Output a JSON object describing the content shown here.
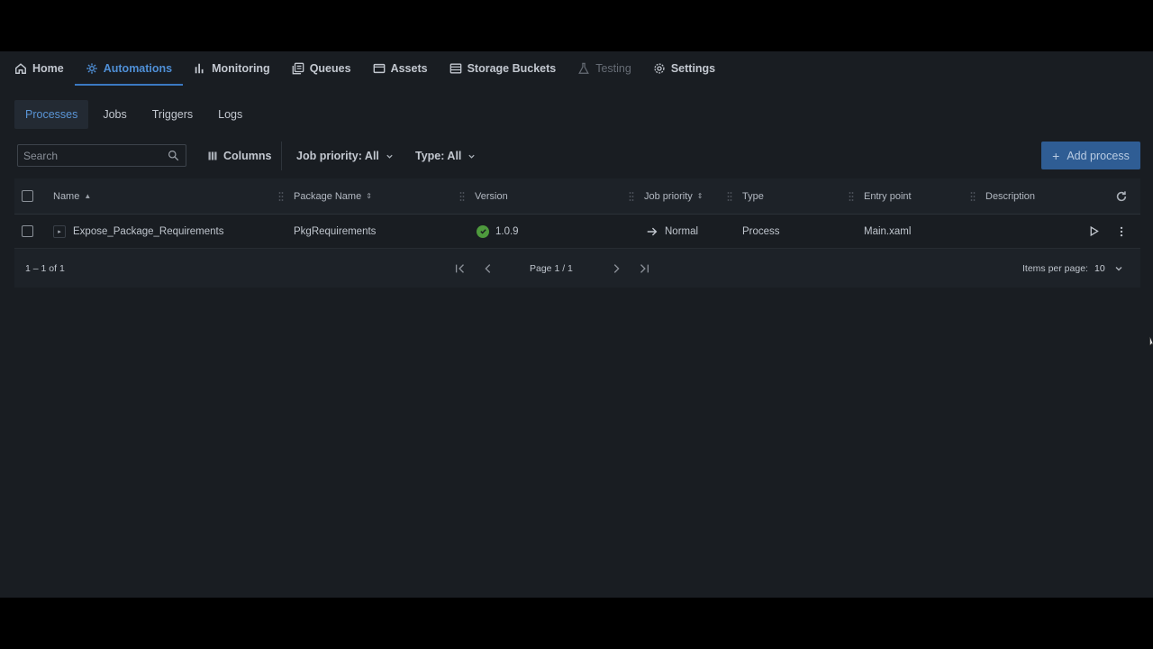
{
  "nav": {
    "items": [
      {
        "label": "Home",
        "icon": "home-icon",
        "state": "normal"
      },
      {
        "label": "Automations",
        "icon": "automations-icon",
        "state": "active"
      },
      {
        "label": "Monitoring",
        "icon": "monitoring-icon",
        "state": "normal"
      },
      {
        "label": "Queues",
        "icon": "queues-icon",
        "state": "normal"
      },
      {
        "label": "Assets",
        "icon": "assets-icon",
        "state": "normal"
      },
      {
        "label": "Storage Buckets",
        "icon": "storage-buckets-icon",
        "state": "normal"
      },
      {
        "label": "Testing",
        "icon": "testing-flask-icon",
        "state": "disabled"
      },
      {
        "label": "Settings",
        "icon": "gear-icon",
        "state": "normal"
      }
    ]
  },
  "subtabs": [
    "Processes",
    "Jobs",
    "Triggers",
    "Logs"
  ],
  "toolbar": {
    "search_placeholder": "Search",
    "columns_label": "Columns",
    "job_priority_filter": "Job priority: All",
    "type_filter": "Type: All",
    "add_process_label": "Add process"
  },
  "table": {
    "headers": {
      "name": "Name",
      "package": "Package Name",
      "version": "Version",
      "priority": "Job priority",
      "type": "Type",
      "entry": "Entry point",
      "description": "Description"
    },
    "rows": [
      {
        "name": "Expose_Package_Requirements",
        "package": "PkgRequirements",
        "version": "1.0.9",
        "priority": "Normal",
        "type": "Process",
        "entry": "Main.xaml",
        "description": ""
      }
    ]
  },
  "footer": {
    "range": "1 – 1 of 1",
    "page": "Page 1 / 1",
    "items_per_page_label": "Items per page:",
    "items_per_page": "10"
  },
  "colors": {
    "background": "#191d22",
    "accent": "#3b79c2",
    "primary_button": "#2f5d94",
    "success": "#4e9a3d"
  }
}
